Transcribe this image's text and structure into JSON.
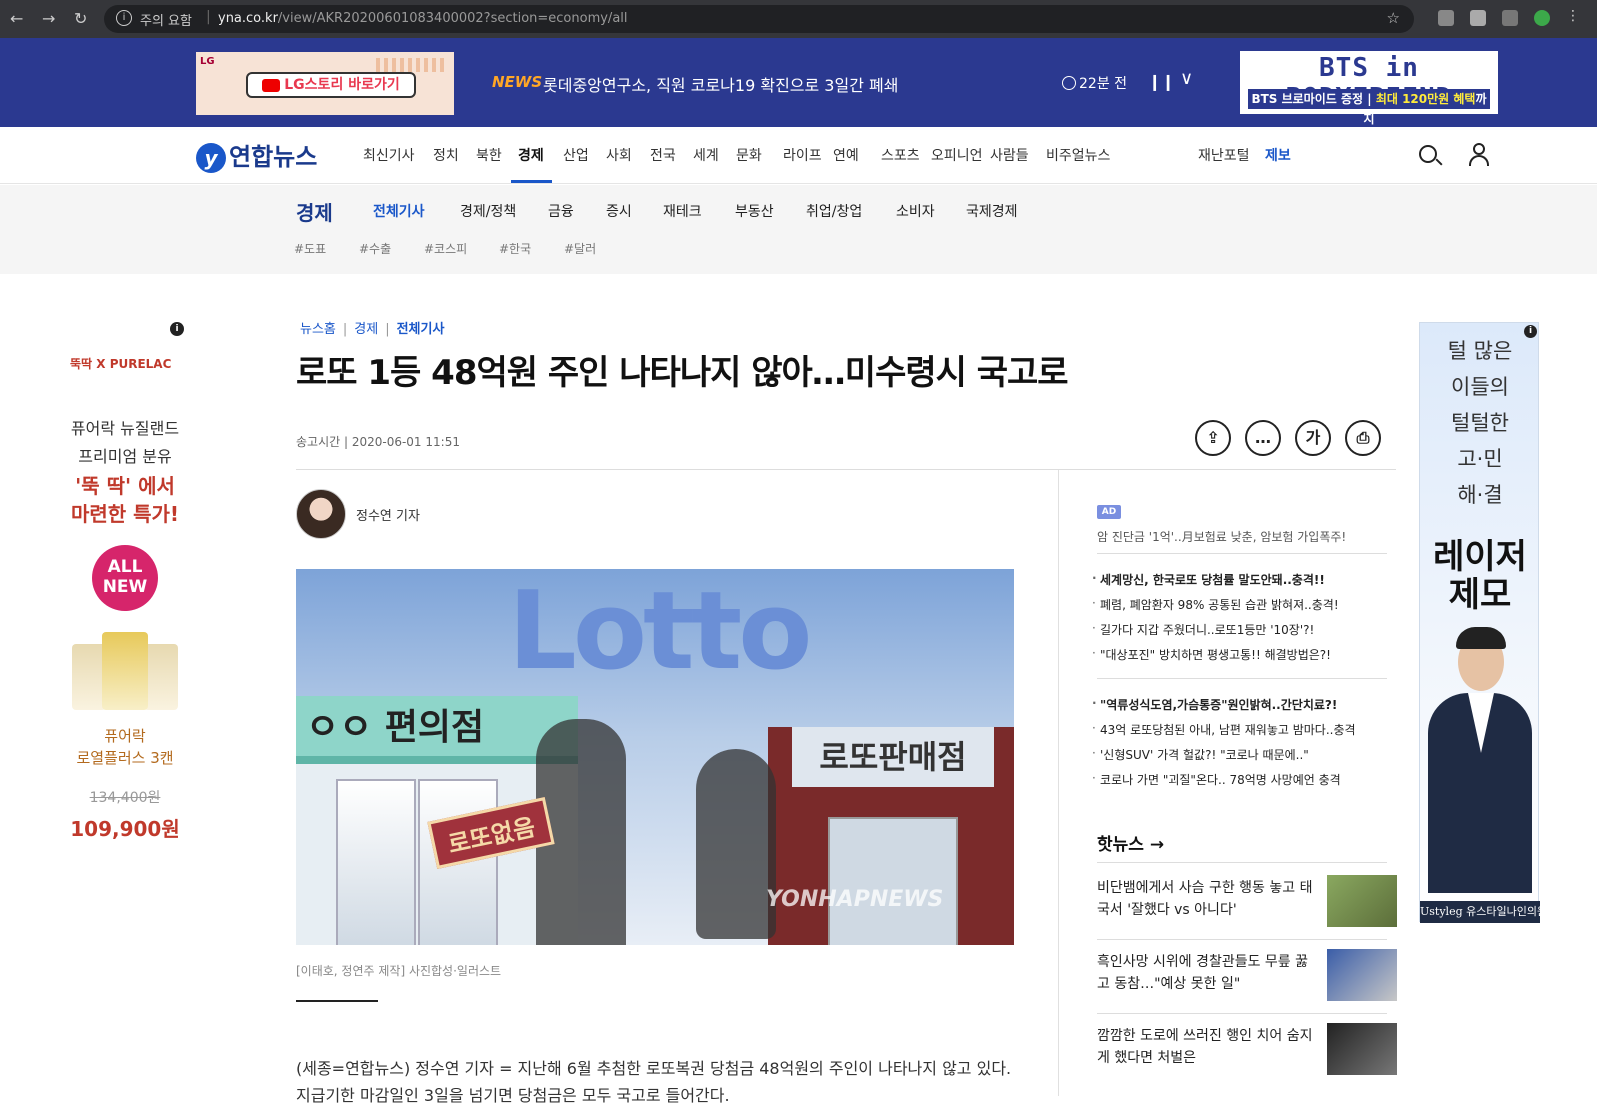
{
  "browser": {
    "security_text": "주의 요함",
    "url_domain": "yna.co.kr",
    "url_path": "/view/AKR20200601083400002?section=economy/all"
  },
  "topbar": {
    "lg_ad": {
      "brand": "LG",
      "button": "LG스토리 바로가기"
    },
    "news_label": "NEWS",
    "news_headline": "롯데중앙연구소, 직원 코로나19 확진으로 3일간 폐쇄",
    "time_ago": "22분 전",
    "bts_ad": {
      "title": "BTS in BODYFRIEND",
      "sub_left": "BTS 브로마이드 증정",
      "sub_right": "최대 120만원 혜택",
      "sub_tail": "까지"
    }
  },
  "mainnav": {
    "logo": "연합뉴스",
    "items": [
      "최신기사",
      "정치",
      "북한",
      "경제",
      "산업",
      "사회",
      "전국",
      "세계",
      "문화",
      "라이프",
      "연예",
      "스포츠",
      "오피니언",
      "사람들",
      "비주얼뉴스"
    ],
    "active": "경제",
    "disaster": "재난포털",
    "report": "제보"
  },
  "subnav": {
    "section": "경제",
    "items": [
      "전체기사",
      "경제/정책",
      "금융",
      "증시",
      "재테크",
      "부동산",
      "취업/창업",
      "소비자",
      "국제경제"
    ],
    "active": "전체기사",
    "tags": [
      "#도표",
      "#수출",
      "#코스피",
      "#한국",
      "#달러"
    ]
  },
  "left_ad": {
    "brand": "뚝딱 X PURELAC",
    "line1": "퓨어락 뉴질랜드",
    "line2": "프리미엄 분유",
    "line3": "'뚝 딱' 에서",
    "line4": "마련한 특가!",
    "badge": "ALL NEW",
    "product1": "퓨어락",
    "product2": "로열플러스 3캔",
    "old_price": "134,400원",
    "price": "109,900원"
  },
  "article": {
    "breadcrumb": [
      "뉴스홈",
      "경제",
      "전체기사"
    ],
    "headline": "로또 1등 48억원 주인 나타나지 않아…미수령시 국고로",
    "pubtime": "송고시간 | 2020-06-01 11:51",
    "reporter": "정수연 기자",
    "image_sign1": "ㅇㅇ 편의점",
    "image_sign2": "로또판매점",
    "image_stamp": "로또없음",
    "image_lotto": "Lotto",
    "image_watermark": "YONHAPNEWS",
    "caption": "[이태호, 정연주 제작] 사진합성·일러스트",
    "body": "(세종=연합뉴스) 정수연 기자 = 지난해 6월 추첨한 로또복권 당첨금 48억원의 주인이 나타나지 않고 있다. 지급기한 마감일인 3일을 넘기면 당첨금은 모두 국고로 들어간다."
  },
  "tools": [
    "share",
    "comment",
    "font",
    "print"
  ],
  "tool_font_label": "가",
  "right_col": {
    "ad_tag": "AD",
    "ad_intro": "암 진단금 '1억'..月보험료 낮춘, 암보험 가입폭주!",
    "ad_links_1": [
      "세계망신, 한국로또 당첨률 말도안돼..충격!!",
      "폐렴, 폐암환자 98% 공통된 습관 밝혀져..충격!",
      "길가다 지갑 주웠더니..로또1등만 '10장'?!",
      "\"대상포진\" 방치하면 평생고통!! 해결방법은?!"
    ],
    "ad_links_2": [
      "\"역류성식도염,가슴통증\"원인밝혀..간단치료?!",
      "43억 로또당첨된 아내, 남편 재워놓고 밤마다..충격",
      "'신형SUV' 가격 헐값?! \"코로나 때문에..\"",
      "코로나 가면 \"괴질\"온다.. 78억명 사망예언 충격"
    ],
    "hot_title": "핫뉴스",
    "hot_items": [
      "비단뱀에게서 사슴 구한 행동 놓고 태국서 '잘했다 vs 아니다'",
      "흑인사망 시위에 경찰관들도 무릎 꿇고 동참…\"예상 못한 일\"",
      "깜깜한 도로에 쓰러진 행인 치어 숨지게 했다면 처벌은"
    ]
  },
  "right_ad": {
    "lines": [
      "털 많은",
      "이들의",
      "털털한",
      "고·민",
      "해·결"
    ],
    "title": "레이저\n제모",
    "footer": "Ustyleg 유스타일나인의원"
  }
}
